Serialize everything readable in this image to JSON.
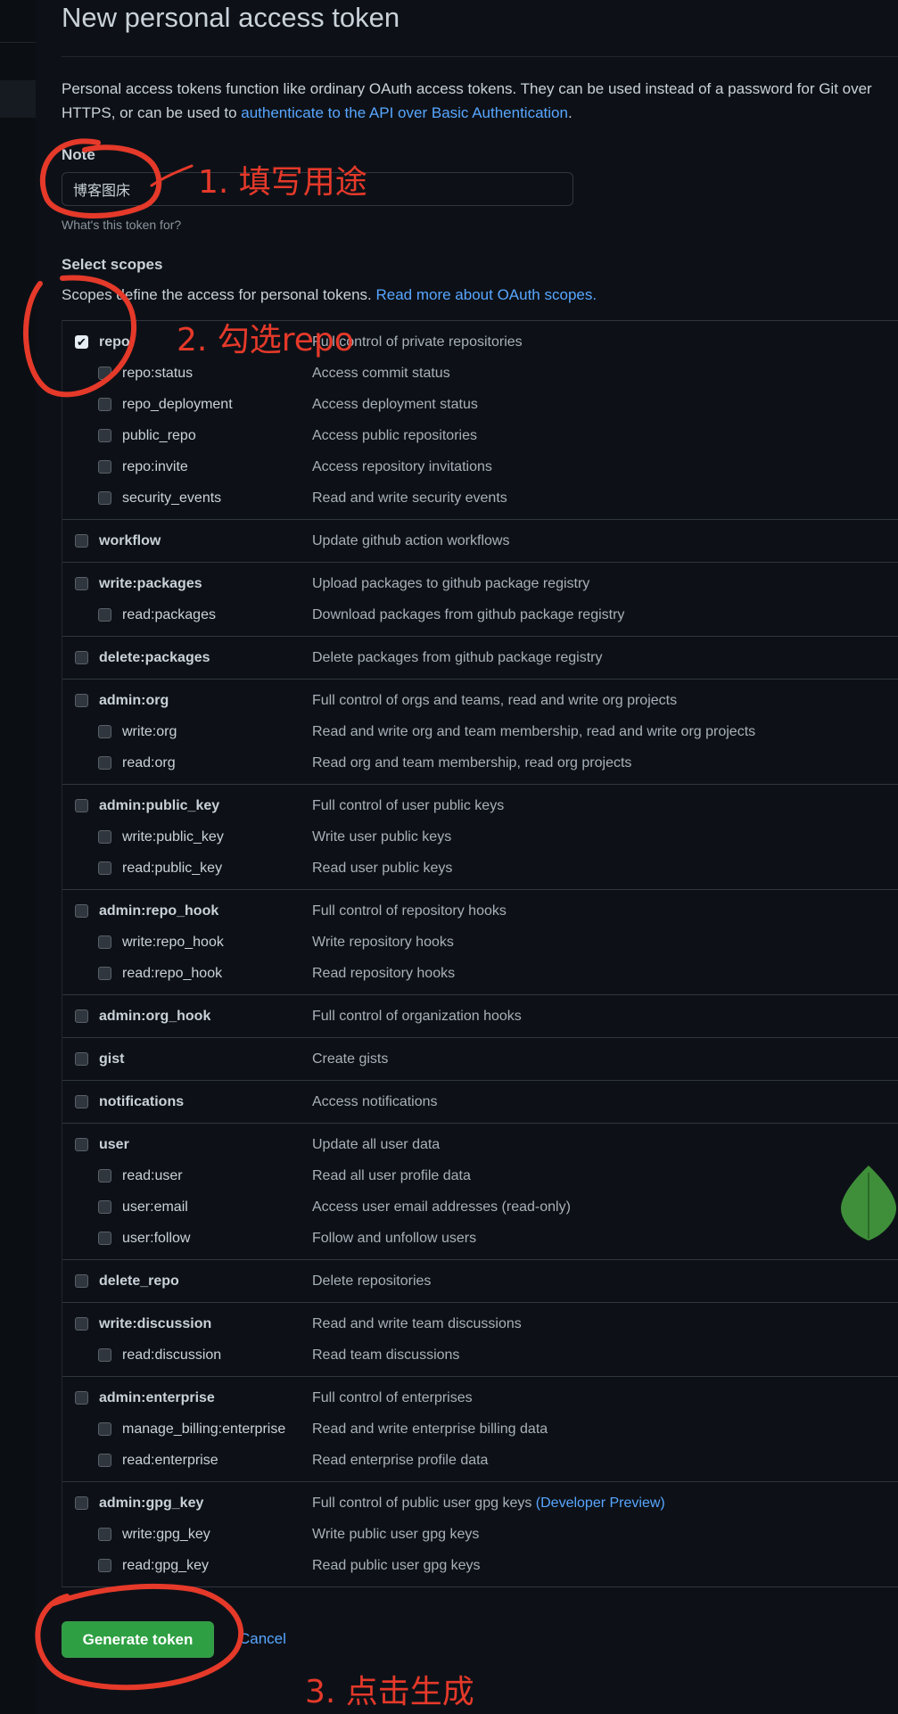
{
  "page": {
    "title": "New personal access token",
    "intro_text_before_link": "Personal access tokens function like ordinary OAuth access tokens. They can be used instead of a password for Git over",
    "intro_text_line2_before_link": "HTTPS, or can be used to ",
    "intro_link": "authenticate to the API over Basic Authentication",
    "intro_text_after_link": "."
  },
  "note": {
    "label": "Note",
    "value": "博客图床",
    "hint": "What's this token for?"
  },
  "scopes": {
    "title": "Select scopes",
    "description": "Scopes define the access for personal tokens. ",
    "description_link": "Read more about OAuth scopes.",
    "groups": [
      {
        "items": [
          {
            "name": "repo",
            "desc": "Full control of private repositories",
            "checked": true,
            "level": "parent"
          },
          {
            "name": "repo:status",
            "desc": "Access commit status",
            "checked": false,
            "level": "child"
          },
          {
            "name": "repo_deployment",
            "desc": "Access deployment status",
            "checked": false,
            "level": "child"
          },
          {
            "name": "public_repo",
            "desc": "Access public repositories",
            "checked": false,
            "level": "child"
          },
          {
            "name": "repo:invite",
            "desc": "Access repository invitations",
            "checked": false,
            "level": "child"
          },
          {
            "name": "security_events",
            "desc": "Read and write security events",
            "checked": false,
            "level": "child"
          }
        ]
      },
      {
        "items": [
          {
            "name": "workflow",
            "desc": "Update github action workflows",
            "checked": false,
            "level": "parent"
          }
        ]
      },
      {
        "items": [
          {
            "name": "write:packages",
            "desc": "Upload packages to github package registry",
            "checked": false,
            "level": "parent"
          },
          {
            "name": "read:packages",
            "desc": "Download packages from github package registry",
            "checked": false,
            "level": "child"
          }
        ]
      },
      {
        "items": [
          {
            "name": "delete:packages",
            "desc": "Delete packages from github package registry",
            "checked": false,
            "level": "parent"
          }
        ]
      },
      {
        "items": [
          {
            "name": "admin:org",
            "desc": "Full control of orgs and teams, read and write org projects",
            "checked": false,
            "level": "parent"
          },
          {
            "name": "write:org",
            "desc": "Read and write org and team membership, read and write org projects",
            "checked": false,
            "level": "child"
          },
          {
            "name": "read:org",
            "desc": "Read org and team membership, read org projects",
            "checked": false,
            "level": "child"
          }
        ]
      },
      {
        "items": [
          {
            "name": "admin:public_key",
            "desc": "Full control of user public keys",
            "checked": false,
            "level": "parent"
          },
          {
            "name": "write:public_key",
            "desc": "Write user public keys",
            "checked": false,
            "level": "child"
          },
          {
            "name": "read:public_key",
            "desc": "Read user public keys",
            "checked": false,
            "level": "child"
          }
        ]
      },
      {
        "items": [
          {
            "name": "admin:repo_hook",
            "desc": "Full control of repository hooks",
            "checked": false,
            "level": "parent"
          },
          {
            "name": "write:repo_hook",
            "desc": "Write repository hooks",
            "checked": false,
            "level": "child"
          },
          {
            "name": "read:repo_hook",
            "desc": "Read repository hooks",
            "checked": false,
            "level": "child"
          }
        ]
      },
      {
        "items": [
          {
            "name": "admin:org_hook",
            "desc": "Full control of organization hooks",
            "checked": false,
            "level": "parent"
          }
        ]
      },
      {
        "items": [
          {
            "name": "gist",
            "desc": "Create gists",
            "checked": false,
            "level": "parent"
          }
        ]
      },
      {
        "items": [
          {
            "name": "notifications",
            "desc": "Access notifications",
            "checked": false,
            "level": "parent"
          }
        ]
      },
      {
        "items": [
          {
            "name": "user",
            "desc": "Update all user data",
            "checked": false,
            "level": "parent"
          },
          {
            "name": "read:user",
            "desc": "Read all user profile data",
            "checked": false,
            "level": "child"
          },
          {
            "name": "user:email",
            "desc": "Access user email addresses (read-only)",
            "checked": false,
            "level": "child"
          },
          {
            "name": "user:follow",
            "desc": "Follow and unfollow users",
            "checked": false,
            "level": "child"
          }
        ]
      },
      {
        "items": [
          {
            "name": "delete_repo",
            "desc": "Delete repositories",
            "checked": false,
            "level": "parent"
          }
        ]
      },
      {
        "items": [
          {
            "name": "write:discussion",
            "desc": "Read and write team discussions",
            "checked": false,
            "level": "parent"
          },
          {
            "name": "read:discussion",
            "desc": "Read team discussions",
            "checked": false,
            "level": "child"
          }
        ]
      },
      {
        "items": [
          {
            "name": "admin:enterprise",
            "desc": "Full control of enterprises",
            "checked": false,
            "level": "parent"
          },
          {
            "name": "manage_billing:enterprise",
            "desc": "Read and write enterprise billing data",
            "checked": false,
            "level": "child"
          },
          {
            "name": "read:enterprise",
            "desc": "Read enterprise profile data",
            "checked": false,
            "level": "child"
          }
        ]
      },
      {
        "items": [
          {
            "name": "admin:gpg_key",
            "desc": "Full control of public user gpg keys",
            "desc_extra": "(Developer Preview)",
            "checked": false,
            "level": "parent"
          },
          {
            "name": "write:gpg_key",
            "desc": "Write public user gpg keys",
            "checked": false,
            "level": "child"
          },
          {
            "name": "read:gpg_key",
            "desc": "Read public user gpg keys",
            "checked": false,
            "level": "child"
          }
        ]
      }
    ]
  },
  "actions": {
    "generate_label": "Generate token",
    "cancel_label": "Cancel"
  },
  "annotations": {
    "step1": "1. 填写用途",
    "step2": "2. 勾选repo",
    "step3": "3. 点击生成",
    "color": "#e5392a"
  },
  "colors": {
    "background": "#0d1117",
    "link": "#58a6ff",
    "button_green": "#2ea043",
    "watermark_green": "#3f8f3a"
  },
  "icons": {
    "checkbox_checked": "check-mark",
    "watermark": "leaf-icon"
  }
}
